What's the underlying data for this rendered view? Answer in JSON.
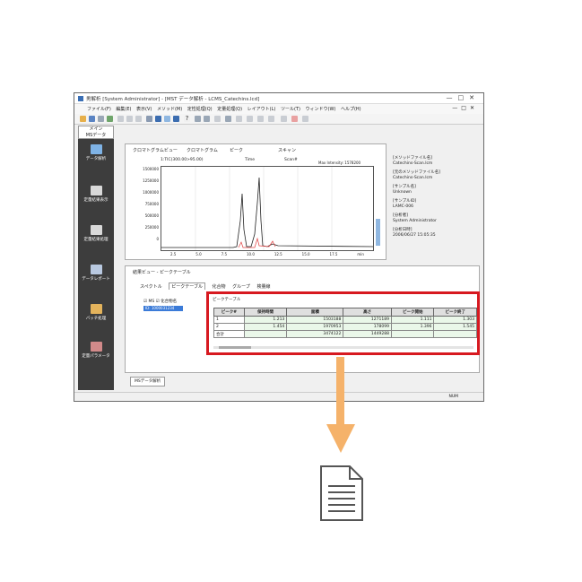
{
  "window": {
    "title": "男解析 [System Administrator] - [MST データ解析 - LCMS_Catechins.lcd]",
    "controls": [
      "—",
      "□",
      "✕"
    ]
  },
  "menubar": {
    "items": [
      "ファイル(F)",
      "編集(E)",
      "表示(V)",
      "メソッド(M)",
      "定性処理(Q)",
      "定量処理(Q)",
      "レイアウト(L)",
      "ツール(T)",
      "ウィンドウ(W)",
      "ヘルプ(H)"
    ],
    "mdi_controls": [
      "—",
      "□",
      "✕"
    ]
  },
  "sidebar": {
    "header": [
      "メイン",
      "MSデータ"
    ],
    "items": [
      {
        "label": "データ解析",
        "icon": "data-analysis-icon"
      },
      {
        "label": "定量結果表示",
        "icon": "quant-results-icon"
      },
      {
        "label": "定量結果処理",
        "icon": "quant-process-icon"
      },
      {
        "label": "データレポート",
        "icon": "data-report-icon"
      },
      {
        "label": "バッチ処理",
        "icon": "batch-icon"
      },
      {
        "label": "定量パラメータ",
        "icon": "quant-param-icon"
      }
    ]
  },
  "chromatogram": {
    "panel_title": "クロマトグラムビュー",
    "tab1": "クロマトグラム",
    "tab2": "ピーク",
    "tab3": "スキャン",
    "header_left": "1:TIC(300.00>95.00)",
    "header_mid": "Time",
    "header_mid2": "Scan#",
    "header_right": "Max Intensity: 1578200",
    "y_ticks": [
      "1500000",
      "1250000",
      "1000000",
      "750000",
      "500000",
      "250000",
      "0"
    ],
    "x_ticks": [
      "2.5",
      "5.0",
      "7.5",
      "10.0",
      "12.5",
      "15.0",
      "17.5"
    ],
    "x_unit": "min"
  },
  "file_info": [
    {
      "label": "[メソッドファイル名]",
      "value": "Catechins-Scan.lcm"
    },
    {
      "label": "[元のメソッドファイル名]",
      "value": "Catechins-Scan.lcm"
    },
    {
      "label": "[サンプル名]",
      "value": "Unknown"
    },
    {
      "label": "[サンプルID]",
      "value": "LAMC-006"
    },
    {
      "label": "[分析者]",
      "value": "System Administrator"
    },
    {
      "label": "[分析日時]",
      "value": "2006/06/27 15:05:35"
    }
  ],
  "results": {
    "panel_title": "結果ビュー - ピークテーブル",
    "tabs": [
      "スペクトル",
      "ピークテーブル",
      "化合物",
      "グループ",
      "検量線"
    ],
    "checkbox1": "MS",
    "checkbox2": "化合物名",
    "tree_item": "ID: 1000031234"
  },
  "peak_table": {
    "caption": "ピークテーブル",
    "headers": [
      "ピーク#",
      "保持時間",
      "面積",
      "高さ",
      "ピーク開始",
      "ピーク終了"
    ],
    "rows": [
      [
        "1",
        "1.213",
        "1503188",
        "1271189",
        "1.111",
        "1.303"
      ],
      [
        "2",
        "1.454",
        "1970953",
        "178099",
        "1.396",
        "1.545"
      ],
      [
        "合計",
        "",
        "3474122",
        "1449288",
        "",
        ""
      ]
    ]
  },
  "bottom_tab": "MSデータ解析",
  "status_text": "NUM"
}
